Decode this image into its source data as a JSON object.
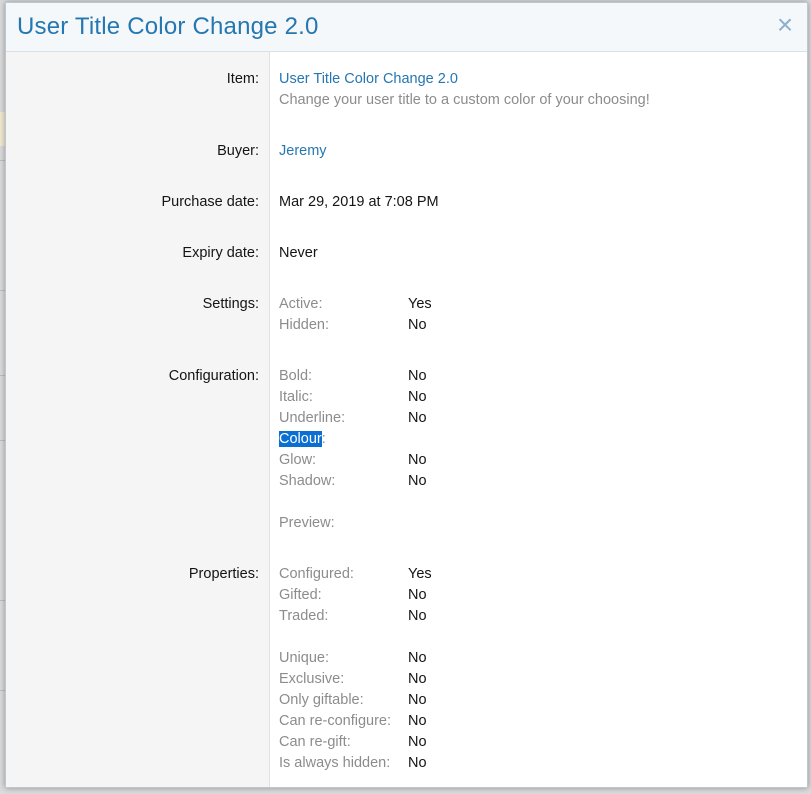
{
  "overlay": {
    "title": "User Title Color Change 2.0",
    "close_icon": "×"
  },
  "item": {
    "label": "Item:",
    "name": "User Title Color Change 2.0",
    "description": "Change your user title to a custom color of your choosing!"
  },
  "buyer": {
    "label": "Buyer:",
    "value": "Jeremy"
  },
  "purchase_date": {
    "label": "Purchase date:",
    "value": "Mar 29, 2019 at 7:08 PM"
  },
  "expiry_date": {
    "label": "Expiry date:",
    "value": "Never"
  },
  "settings": {
    "label": "Settings:",
    "active_label": "Active:",
    "active_value": "Yes",
    "hidden_label": "Hidden:",
    "hidden_value": "No"
  },
  "configuration": {
    "label": "Configuration:",
    "bold_label": "Bold:",
    "bold_value": "No",
    "italic_label": "Italic:",
    "italic_value": "No",
    "underline_label": "Underline:",
    "underline_value": "No",
    "colour_selected": "Colour",
    "colour_rest": ":",
    "glow_label": "Glow:",
    "glow_value": "No",
    "shadow_label": "Shadow:",
    "shadow_value": "No",
    "preview_label": "Preview:"
  },
  "properties": {
    "label": "Properties:",
    "configured_label": "Configured:",
    "configured_value": "Yes",
    "gifted_label": "Gifted:",
    "gifted_value": "No",
    "traded_label": "Traded:",
    "traded_value": "No",
    "unique_label": "Unique:",
    "unique_value": "No",
    "exclusive_label": "Exclusive:",
    "exclusive_value": "No",
    "only_giftable_label": "Only giftable:",
    "only_giftable_value": "No",
    "can_reconfigure_label": "Can re-configure:",
    "can_reconfigure_value": "No",
    "can_regift_label": "Can re-gift:",
    "can_regift_value": "No",
    "always_hidden_label": "Is always hidden:",
    "always_hidden_value": "No"
  },
  "colors": {
    "accent": "#2577b1",
    "selection": "#0a6fd1"
  }
}
